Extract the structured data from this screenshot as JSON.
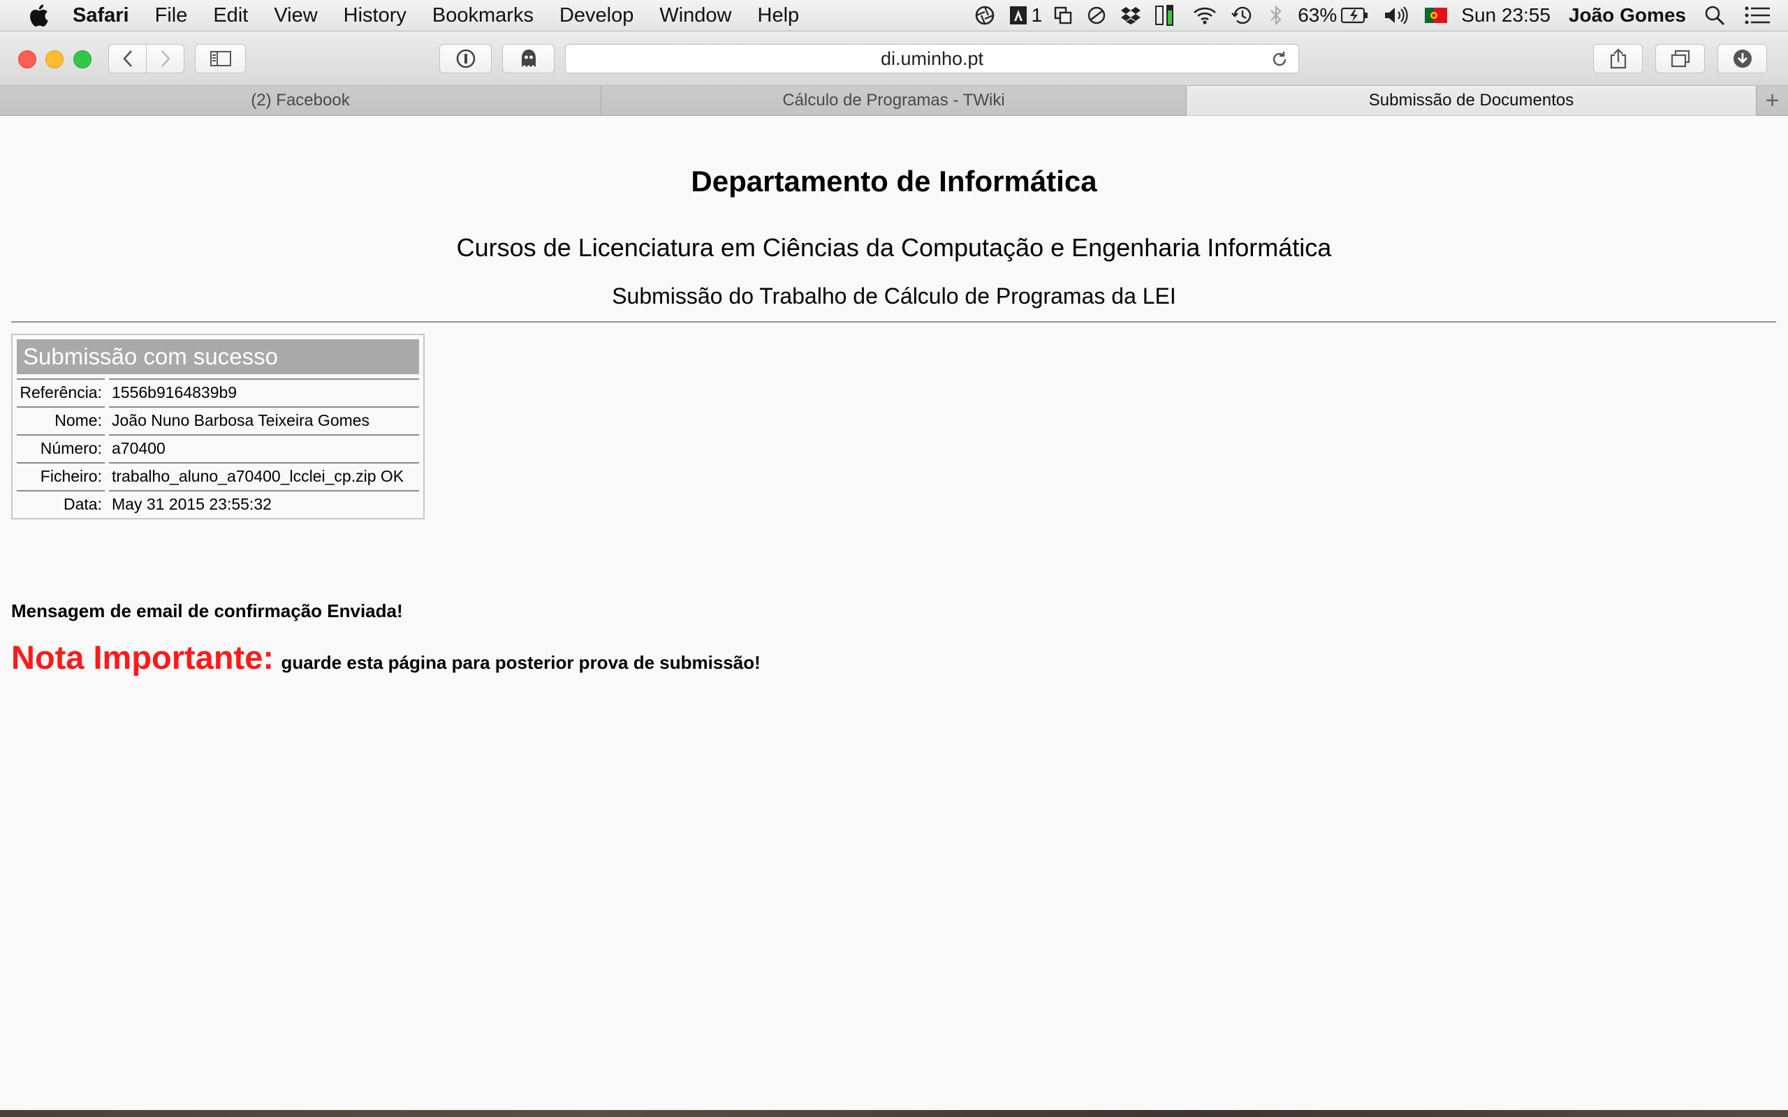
{
  "menubar": {
    "app": "Safari",
    "items": [
      "File",
      "Edit",
      "View",
      "History",
      "Bookmarks",
      "Develop",
      "Window",
      "Help"
    ],
    "status": {
      "adobe_count": "1",
      "battery": "63%",
      "clock": "Sun 23:55",
      "user": "João Gomes"
    }
  },
  "browser": {
    "url": "di.uminho.pt",
    "tabs": [
      "(2) Facebook",
      "Cálculo de Programas - TWiki",
      "Submissão de Documentos"
    ],
    "active_tab": 2,
    "new_tab": "+"
  },
  "page": {
    "title": "Departamento de Informática",
    "course": "Cursos de Licenciatura em Ciências da Computação e Engenharia Informática",
    "subtitle": "Submissão do Trabalho de Cálculo de Programas da LEI",
    "result": {
      "heading": "Submissão com sucesso",
      "rows": [
        {
          "label": "Referência:",
          "value": "1556b9164839b9"
        },
        {
          "label": "Nome:",
          "value": "João Nuno Barbosa Teixeira Gomes"
        },
        {
          "label": "Número:",
          "value": "a70400"
        },
        {
          "label": "Ficheiro:",
          "value": "trabalho_aluno_a70400_lcclei_cp.zip OK"
        },
        {
          "label": "Data:",
          "value": "May 31 2015 23:55:32"
        }
      ]
    },
    "email_message": "Mensagem de email de confirmação Enviada!",
    "note_label": "Nota Importante:",
    "note_text": "guarde esta página para posterior prova de submissão!"
  },
  "colors": {
    "note_red": "#ff1a1a",
    "result_header_bg": "#a9a9a9",
    "traffic_red": "#fc5f57",
    "traffic_yellow": "#fdbc2e",
    "traffic_green": "#33c748"
  }
}
